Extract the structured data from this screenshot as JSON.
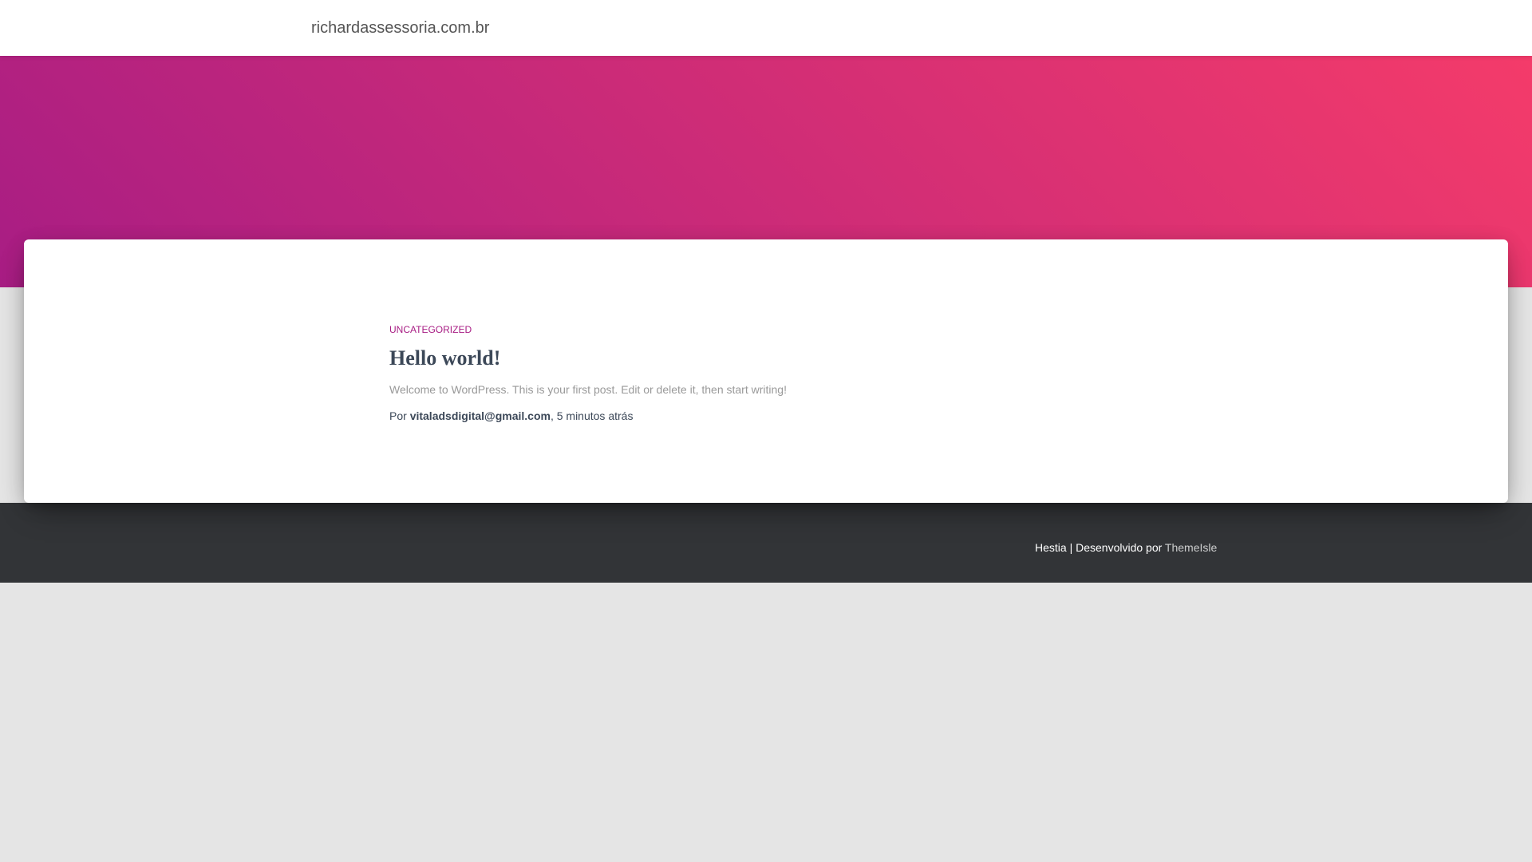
{
  "navbar": {
    "brand": "richardassessoria.com.br"
  },
  "post": {
    "category": "UNCATEGORIZED",
    "title": "Hello world!",
    "excerpt": "Welcome to WordPress. This is your first post. Edit or delete it, then start writing!",
    "meta_prefix": "Por ",
    "author": "vitaladsdigital@gmail.com",
    "meta_suffix": ", 5 minutos atrás"
  },
  "footer": {
    "credit_prefix": "Hestia | Desenvolvido por ",
    "credit_link": "ThemeIsle"
  },
  "colors": {
    "gradient_start": "#a81d84",
    "gradient_end": "#f43b6a",
    "footer_bg": "#323437",
    "page_bg": "#e5e5e5"
  }
}
